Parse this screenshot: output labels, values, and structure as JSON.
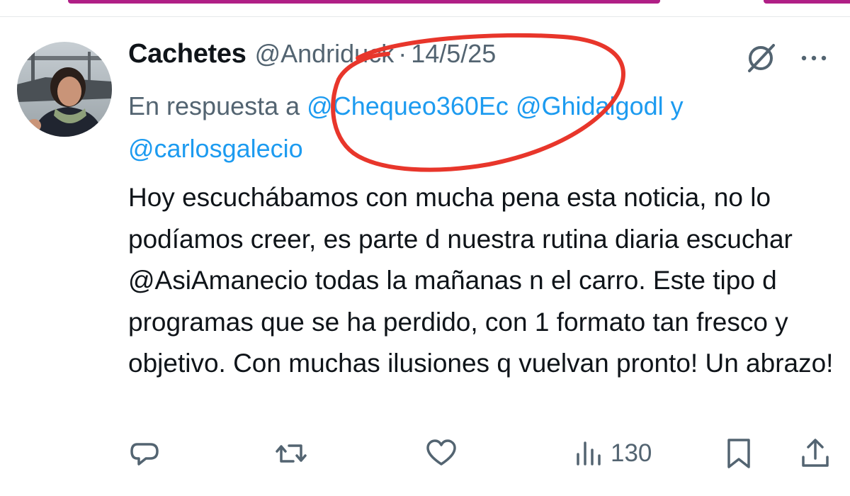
{
  "tweet": {
    "author_name": "Cachetes",
    "handle": "@Andriduck",
    "separator": "·",
    "date": "14/5/25",
    "reply": {
      "prefix": "En respuesta a",
      "mention1": "@Chequeo360Ec",
      "mention2": "@Ghidalgodl",
      "conjunction": "y",
      "mention3": "@carlosgalecio"
    },
    "text": "Hoy escuchábamos con mucha pena esta noticia, no lo podíamos creer, es parte d nuestra rutina diaria escuchar @AsiAmanecio todas la mañanas n el carro.  Este tipo d programas que se ha perdido, con 1 formato tan fresco y objetivo. Con muchas ilusiones q vuelvan pronto! Un abrazo!"
  },
  "actions": {
    "reply_icon": "reply-icon",
    "retweet_icon": "retweet-icon",
    "like_icon": "heart-icon",
    "views_icon": "views-icon",
    "views_count": "130",
    "bookmark_icon": "bookmark-icon",
    "share_icon": "share-icon"
  },
  "colors": {
    "mention": "#1d9bf0",
    "muted": "#536471",
    "annotation_circle": "#e8362b",
    "top_accent": "#b01f86"
  }
}
